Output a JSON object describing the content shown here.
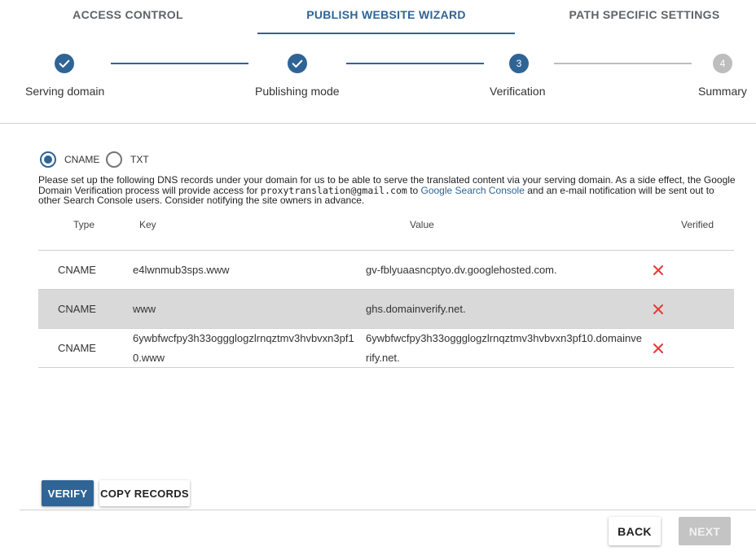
{
  "tabs": [
    {
      "label": "ACCESS CONTROL"
    },
    {
      "label": "PUBLISH WEBSITE WIZARD"
    },
    {
      "label": "PATH SPECIFIC SETTINGS"
    }
  ],
  "stepper": {
    "steps": [
      {
        "label": "Serving domain",
        "status": "completed"
      },
      {
        "label": "Publishing mode",
        "status": "completed"
      },
      {
        "number": "3",
        "label": "Verification",
        "status": "active"
      },
      {
        "number": "4",
        "label": "Summary",
        "status": "pending"
      }
    ]
  },
  "record_type": {
    "options": [
      {
        "label": "CNAME",
        "selected": true
      },
      {
        "label": "TXT",
        "selected": false
      }
    ]
  },
  "description": {
    "part1": "Please set up the following DNS records under your domain for us to be able to serve the translated content via your serving domain. As a side effect, the Google Domain Verification process will provide access for ",
    "email": "proxytranslation@gmail.com",
    "part2": " to ",
    "link": "Google Search Console",
    "part3": " and an e-mail notification will be sent out to other Search Console users. Consider notifying the site owners in advance."
  },
  "table": {
    "headers": {
      "type": "Type",
      "key": "Key",
      "value": "Value",
      "verified": "Verified"
    },
    "rows": [
      {
        "type": "CNAME",
        "key": "e4lwnmub3sps.www",
        "value": "gv-fblyuaasncptyo.dv.googlehosted.com.",
        "verified": false
      },
      {
        "type": "CNAME",
        "key": "www",
        "value": "ghs.domainverify.net.",
        "verified": false
      },
      {
        "type": "CNAME",
        "key": "6ywbfwcfpy3h33oggglogzlrnqztmv3hvbvxn3pf10.www",
        "value": "6ywbfwcfpy3h33oggglogzlrnqztmv3hvbvxn3pf10.domainverify.net.",
        "verified": false
      }
    ]
  },
  "actions": {
    "verify_label": "VERIFY",
    "copy_label": "COPY RECORDS",
    "back_label": "BACK",
    "next_label": "NEXT"
  },
  "colors": {
    "accent": "#2f6496",
    "error": "#e53935",
    "inactive": "#bdbdbd"
  },
  "icons": {
    "completed_step": "check-icon",
    "not_verified": "close-icon"
  }
}
